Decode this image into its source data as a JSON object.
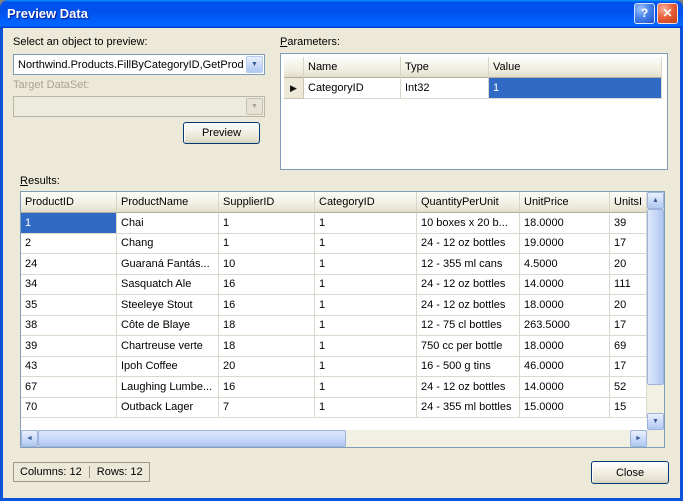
{
  "colors": {
    "selection": "#316AC5",
    "dialog_background": "#ECE9D8",
    "titlebar_blue": "#0050EE",
    "close_button_red": "#C13C15"
  },
  "icons": {
    "help": "?",
    "close": "✕",
    "dropdown_arrow": "▼",
    "current_row_indicator": "▶",
    "scroll_up": "▲",
    "scroll_down": "▼",
    "scroll_left": "◄",
    "scroll_right": "►"
  },
  "titlebar": {
    "title": "Preview Data"
  },
  "object_section": {
    "select_label": "Select an object to preview:",
    "object_value": "Northwind.Products.FillByCategoryID,GetProd",
    "target_dataset_label": "Target DataSet:",
    "target_dataset_value": "",
    "preview_button": "Preview"
  },
  "parameters": {
    "label": "Parameters:",
    "columns": [
      "Name",
      "Type",
      "Value"
    ],
    "rows": [
      [
        "CategoryID",
        "Int32",
        "1"
      ]
    ],
    "selected_cell": {
      "row": 0,
      "col": 2
    }
  },
  "results": {
    "label": "Results:",
    "columns": [
      "ProductID",
      "ProductName",
      "SupplierID",
      "CategoryID",
      "QuantityPerUnit",
      "UnitPrice",
      "UnitsI"
    ],
    "rows": [
      [
        "1",
        "Chai",
        "1",
        "1",
        "10 boxes x 20 b...",
        "18.0000",
        "39"
      ],
      [
        "2",
        "Chang",
        "1",
        "1",
        "24 - 12 oz bottles",
        "19.0000",
        "17"
      ],
      [
        "24",
        "Guaraná Fantás...",
        "10",
        "1",
        "12 - 355 ml cans",
        "4.5000",
        "20"
      ],
      [
        "34",
        "Sasquatch Ale",
        "16",
        "1",
        "24 - 12 oz bottles",
        "14.0000",
        "111"
      ],
      [
        "35",
        "Steeleye Stout",
        "16",
        "1",
        "24 - 12 oz bottles",
        "18.0000",
        "20"
      ],
      [
        "38",
        "Côte de Blaye",
        "18",
        "1",
        "12 - 75 cl bottles",
        "263.5000",
        "17"
      ],
      [
        "39",
        "Chartreuse verte",
        "18",
        "1",
        "750 cc per bottle",
        "18.0000",
        "69"
      ],
      [
        "43",
        "Ipoh Coffee",
        "20",
        "1",
        "16 - 500 g tins",
        "46.0000",
        "17"
      ],
      [
        "67",
        "Laughing Lumbe...",
        "16",
        "1",
        "24 - 12 oz bottles",
        "14.0000",
        "52"
      ],
      [
        "70",
        "Outback Lager",
        "7",
        "1",
        "24 - 355 ml bottles",
        "15.0000",
        "15"
      ]
    ],
    "selected_cell": {
      "row": 0,
      "col": 0
    }
  },
  "statusbar": {
    "columns_text": "Columns: 12",
    "rows_text": "Rows: 12"
  },
  "footer": {
    "close_button": "Close"
  }
}
